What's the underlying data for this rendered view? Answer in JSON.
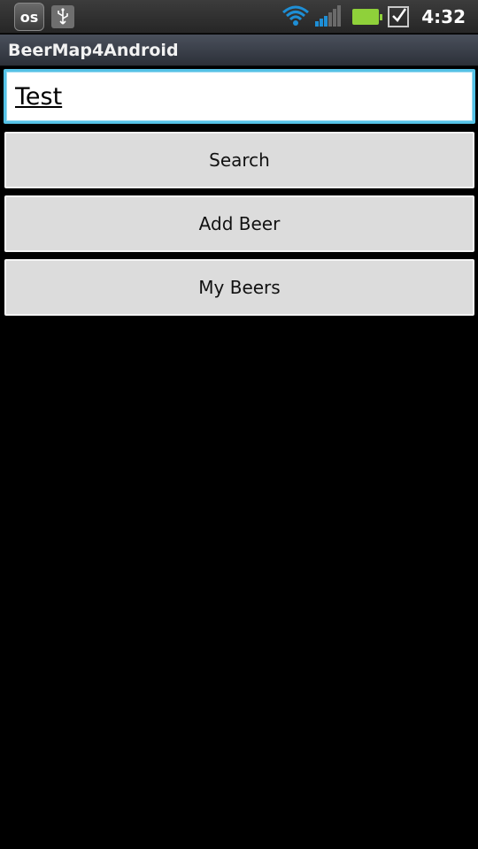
{
  "status_bar": {
    "time": "4:32",
    "icons": [
      "lastfm-icon",
      "usb-icon",
      "wifi-icon",
      "signal-icon",
      "battery-icon",
      "task-check-icon"
    ],
    "lastfm_label": "os",
    "battery_color": "#8fd13a"
  },
  "app": {
    "title": "BeerMap4Android"
  },
  "search": {
    "value": "Test",
    "focus_color": "#55c2e6"
  },
  "buttons": {
    "search_label": "Search",
    "add_beer_label": "Add Beer",
    "my_beers_label": "My Beers"
  }
}
